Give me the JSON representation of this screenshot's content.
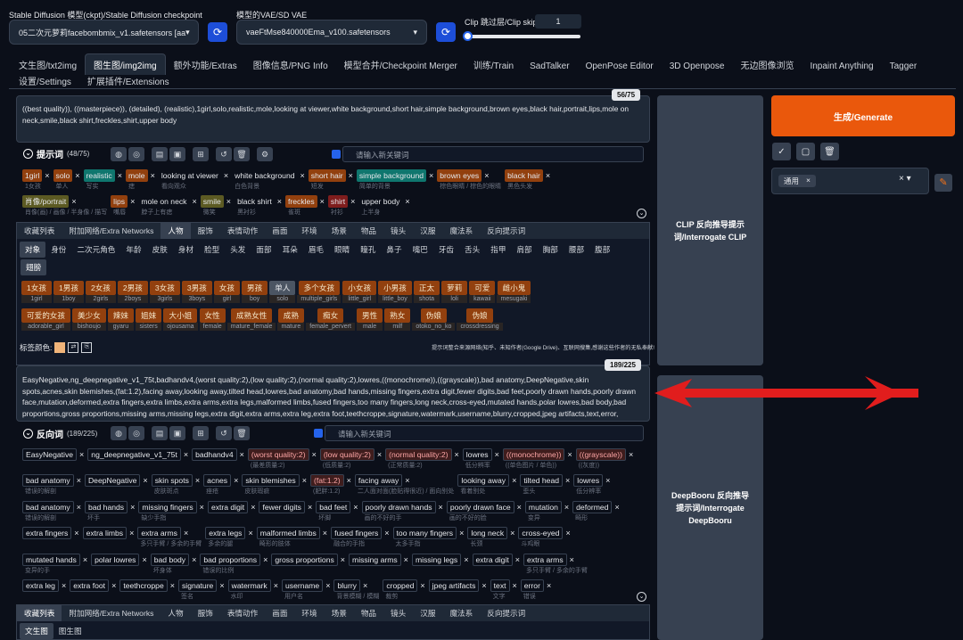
{
  "top": {
    "ckpt_label": "Stable Diffusion 模型(ckpt)/Stable Diffusion checkpoint",
    "ckpt_value": "05二次元萝莉facebombmix_v1.safetensors [aa",
    "vae_label": "模型的VAE/SD VAE",
    "vae_value": "vaeFtMse840000Ema_v100.safetensors",
    "clip_label": "Clip 跳过层/Clip skip",
    "clip_value": "1"
  },
  "tabs": [
    "文生图/txt2img",
    "图生图/img2img",
    "额外功能/Extras",
    "图像信息/PNG Info",
    "模型合并/Checkpoint Merger",
    "训练/Train",
    "SadTalker",
    "OpenPose Editor",
    "3D Openpose",
    "无边图像浏览",
    "Inpaint Anything",
    "Tagger"
  ],
  "tabs2": [
    "设置/Settings",
    "扩展插件/Extensions"
  ],
  "prompt": {
    "counter": "56/75",
    "text": "((best quality)), ((masterpiece)), (detailed), (realistic),1girl,solo,realistic,mole,looking at viewer,white background,short hair,simple background,brown eyes,black hair,portrait,lips,mole on neck,smile,black shirt,freckles,shirt,upper body",
    "title": "提示词",
    "count": "(48/75)",
    "input_placeholder": "请输入新关键词"
  },
  "prompt_tags_row1": [
    {
      "t": "1girl",
      "tr": "1女孩",
      "c": "brown"
    },
    {
      "t": "solo",
      "tr": "单人",
      "c": "brown"
    },
    {
      "t": "realistic",
      "tr": "写实",
      "c": "teal"
    },
    {
      "t": "mole",
      "tr": "痣",
      "c": "brown"
    },
    {
      "t": "looking at viewer",
      "tr": "看向观众",
      "c": "plain"
    },
    {
      "t": "white background",
      "tr": "白色背景",
      "c": "plain"
    },
    {
      "t": "short hair",
      "tr": "短发",
      "c": "brown"
    },
    {
      "t": "simple background",
      "tr": "简单的背景",
      "c": "teal"
    },
    {
      "t": "brown eyes",
      "tr": "棕色眼睛 / 棕色的眼睛",
      "c": "brown"
    },
    {
      "t": "black hair",
      "tr": "黑色头发",
      "c": "brown"
    }
  ],
  "prompt_tags_row2": [
    {
      "t": "肖像/portrait",
      "tr": "肖像(画) / 画像 / 半身像 / 描写",
      "c": "olive"
    },
    {
      "t": "lips",
      "tr": "嘴唇",
      "c": "brown"
    },
    {
      "t": "mole on neck",
      "tr": "脖子上有痣",
      "c": "plain"
    },
    {
      "t": "smile",
      "tr": "微笑",
      "c": "olive"
    },
    {
      "t": "black shirt",
      "tr": "黑衬衫",
      "c": "plain"
    },
    {
      "t": "freckles",
      "tr": "雀斑",
      "c": "brown"
    },
    {
      "t": "shirt",
      "tr": "衬衫",
      "c": "pink"
    },
    {
      "t": "upper body",
      "tr": "上半身",
      "c": "plain"
    }
  ],
  "cat_tabs": [
    "收藏列表",
    "附加网络/Extra Networks",
    "人物",
    "服饰",
    "表情动作",
    "画面",
    "环境",
    "场景",
    "物品",
    "镜头",
    "汉服",
    "魔法系",
    "反向提示词"
  ],
  "sub_tabs": [
    "对象",
    "身份",
    "二次元角色",
    "年龄",
    "皮肤",
    "身材",
    "脸型",
    "头发",
    "面部",
    "耳朵",
    "眉毛",
    "眼睛",
    "瞳孔",
    "鼻子",
    "嘴巴",
    "牙齿",
    "舌头",
    "指甲",
    "肩部",
    "胸部",
    "腰部",
    "腹部"
  ],
  "sub_tab2": "翅膀",
  "kw_row1": [
    {
      "a": "1女孩",
      "b": "1girl",
      "gray": false
    },
    {
      "a": "1男孩",
      "b": "1boy",
      "gray": false
    },
    {
      "a": "2女孩",
      "b": "2girls",
      "gray": false
    },
    {
      "a": "2男孩",
      "b": "2boys",
      "gray": false
    },
    {
      "a": "3女孩",
      "b": "3girls",
      "gray": false
    },
    {
      "a": "3男孩",
      "b": "3boys",
      "gray": false
    },
    {
      "a": "女孩",
      "b": "girl",
      "gray": false
    },
    {
      "a": "男孩",
      "b": "boy",
      "gray": false
    },
    {
      "a": "单人",
      "b": "solo",
      "gray": true
    },
    {
      "a": "多个女孩",
      "b": "multiple_girls",
      "gray": false
    },
    {
      "a": "小女孩",
      "b": "little_girl",
      "gray": false
    },
    {
      "a": "小男孩",
      "b": "little_boy",
      "gray": false
    },
    {
      "a": "正太",
      "b": "shota",
      "gray": false
    },
    {
      "a": "萝莉",
      "b": "loli",
      "gray": false
    },
    {
      "a": "可爱",
      "b": "kawaii",
      "gray": false
    },
    {
      "a": "雌小鬼",
      "b": "mesugaki",
      "gray": false
    }
  ],
  "kw_row2": [
    {
      "a": "可爱的女孩",
      "b": "adorable_girl"
    },
    {
      "a": "美少女",
      "b": "bishoujo"
    },
    {
      "a": "辣妹",
      "b": "gyaru"
    },
    {
      "a": "姐妹",
      "b": "sisters"
    },
    {
      "a": "大小姐",
      "b": "ojousama"
    },
    {
      "a": "女性",
      "b": "female"
    },
    {
      "a": "成熟女性",
      "b": "mature_female"
    },
    {
      "a": "成熟",
      "b": "mature"
    },
    {
      "a": "痴女",
      "b": "female_pervert"
    },
    {
      "a": "男性",
      "b": "male"
    },
    {
      "a": "熟女",
      "b": "milf"
    },
    {
      "a": "伪娘",
      "b": "otoko_no_ko"
    },
    {
      "a": "伪娘",
      "b": "crossdressing"
    }
  ],
  "tag_color_label": "标签颜色:",
  "notice": "提示词整合来源网络(知乎、未知作者(Google Drive)、互联网搜集,感谢这些作者的无私奉献!",
  "negative": {
    "counter": "189/225",
    "text": "EasyNegative,ng_deepnegative_v1_75t,badhandv4,(worst quality:2),(low quality:2),(normal quality:2),lowres,((monochrome)),((grayscale)),bad anatomy,DeepNegative,skin spots,acnes,skin blemishes,(fat:1.2),facing away,looking away,tilted head,lowres,bad anatomy,bad hands,missing fingers,extra digit,fewer digits,bad feet,poorly drawn hands,poorly drawn face,mutation,deformed,extra fingers,extra limbs,extra arms,extra legs,malformed limbs,fused fingers,too many fingers,long neck,cross-eyed,mutated hands,polar lowres,bad body,bad proportions,gross proportions,missing arms,missing legs,extra digit,extra arms,extra leg,extra foot,teethcroppe,signature,watermark,username,blurry,cropped,jpeg artifacts,text,error,",
    "title": "反向词",
    "count": "(189/225)",
    "input_placeholder": "请输入新关键词"
  },
  "neg_rows": [
    [
      {
        "t": "EasyNegative",
        "tr": ""
      },
      {
        "t": "ng_deepnegative_v1_75t",
        "tr": ""
      },
      {
        "t": "badhandv4",
        "tr": ""
      },
      {
        "t": "(worst quality:2)",
        "tr": "(最差质量:2)",
        "r": true
      },
      {
        "t": "(low quality:2)",
        "tr": "(低质量:2)",
        "r": true
      },
      {
        "t": "(normal quality:2)",
        "tr": "(正常质量:2)",
        "r": true
      },
      {
        "t": "lowres",
        "tr": "低分辨率"
      },
      {
        "t": "((monochrome))",
        "tr": "((单色图片 / 单色))",
        "r": true
      },
      {
        "t": "((grayscale))",
        "tr": "((灰度))",
        "r": true
      }
    ],
    [
      {
        "t": "bad anatomy",
        "tr": "错误的解剖"
      },
      {
        "t": "DeepNegative",
        "tr": ""
      },
      {
        "t": "skin spots",
        "tr": "皮肤斑点"
      },
      {
        "t": "acnes",
        "tr": "痤疮"
      },
      {
        "t": "skin blemishes",
        "tr": "皮肤瑕疵"
      },
      {
        "t": "(fat:1.2)",
        "tr": "(肥胖:1.2)",
        "r": true
      },
      {
        "t": "facing away",
        "tr": "二人面对面(脸贴得很近) / 面向别处"
      },
      {
        "t": "looking away",
        "tr": "看着别处"
      },
      {
        "t": "tilted head",
        "tr": "歪头"
      },
      {
        "t": "lowres",
        "tr": "低分辨率"
      }
    ],
    [
      {
        "t": "bad anatomy",
        "tr": "错误的解剖"
      },
      {
        "t": "bad hands",
        "tr": "坏手"
      },
      {
        "t": "missing fingers",
        "tr": "缺少手指"
      },
      {
        "t": "extra digit",
        "tr": ""
      },
      {
        "t": "fewer digits",
        "tr": ""
      },
      {
        "t": "bad feet",
        "tr": "坏脚"
      },
      {
        "t": "poorly drawn hands",
        "tr": "画的不好的手"
      },
      {
        "t": "poorly drawn face",
        "tr": "画的不好的脸"
      },
      {
        "t": "mutation",
        "tr": "变异"
      },
      {
        "t": "deformed",
        "tr": "畸形"
      }
    ],
    [
      {
        "t": "extra fingers",
        "tr": ""
      },
      {
        "t": "extra limbs",
        "tr": ""
      },
      {
        "t": "extra arms",
        "tr": "多只手臂 / 多余的手臂"
      },
      {
        "t": "extra legs",
        "tr": "多余的腿"
      },
      {
        "t": "malformed limbs",
        "tr": "畸形的肢体"
      },
      {
        "t": "fused fingers",
        "tr": "融合的手指"
      },
      {
        "t": "too many fingers",
        "tr": "太多手指"
      },
      {
        "t": "long neck",
        "tr": "长颈"
      },
      {
        "t": "cross-eyed",
        "tr": "斗鸡眼"
      }
    ],
    [
      {
        "t": "mutated hands",
        "tr": "变异的手"
      },
      {
        "t": "polar lowres",
        "tr": ""
      },
      {
        "t": "bad body",
        "tr": "坏身体"
      },
      {
        "t": "bad proportions",
        "tr": "错误的比例"
      },
      {
        "t": "gross proportions",
        "tr": ""
      },
      {
        "t": "missing arms",
        "tr": ""
      },
      {
        "t": "missing legs",
        "tr": ""
      },
      {
        "t": "extra digit",
        "tr": ""
      },
      {
        "t": "extra arms",
        "tr": "多只手臂 / 多余的手臂"
      }
    ],
    [
      {
        "t": "extra leg",
        "tr": ""
      },
      {
        "t": "extra foot",
        "tr": ""
      },
      {
        "t": "teethcroppe",
        "tr": ""
      },
      {
        "t": "signature",
        "tr": "签名"
      },
      {
        "t": "watermark",
        "tr": "水印"
      },
      {
        "t": "username",
        "tr": "用户名"
      },
      {
        "t": "blurry",
        "tr": "背景模糊 / 模糊"
      },
      {
        "t": "cropped",
        "tr": "裁剪"
      },
      {
        "t": "jpeg artifacts",
        "tr": ""
      },
      {
        "t": "text",
        "tr": "文字"
      },
      {
        "t": "error",
        "tr": "错误"
      }
    ]
  ],
  "bottom_tabs": [
    "收藏列表",
    "附加网络/Extra Networks",
    "人物",
    "服饰",
    "表情动作",
    "画面",
    "环境",
    "场景",
    "物品",
    "镜头",
    "汉服",
    "魔法系",
    "反向提示词"
  ],
  "bottom_sub": [
    "文生图",
    "图生图"
  ],
  "interrogate_clip": "CLIP 反向推导提示词/Interrogate CLIP",
  "interrogate_deepbooru": "DeepBooru 反向推导提示词/Interrogate DeepBooru",
  "generate": "生成/Generate",
  "style_value": "通用",
  "colors": {
    "accent_orange": "#ea580c",
    "arrow_red": "#e11d1d",
    "bg": "#0b0f19"
  }
}
